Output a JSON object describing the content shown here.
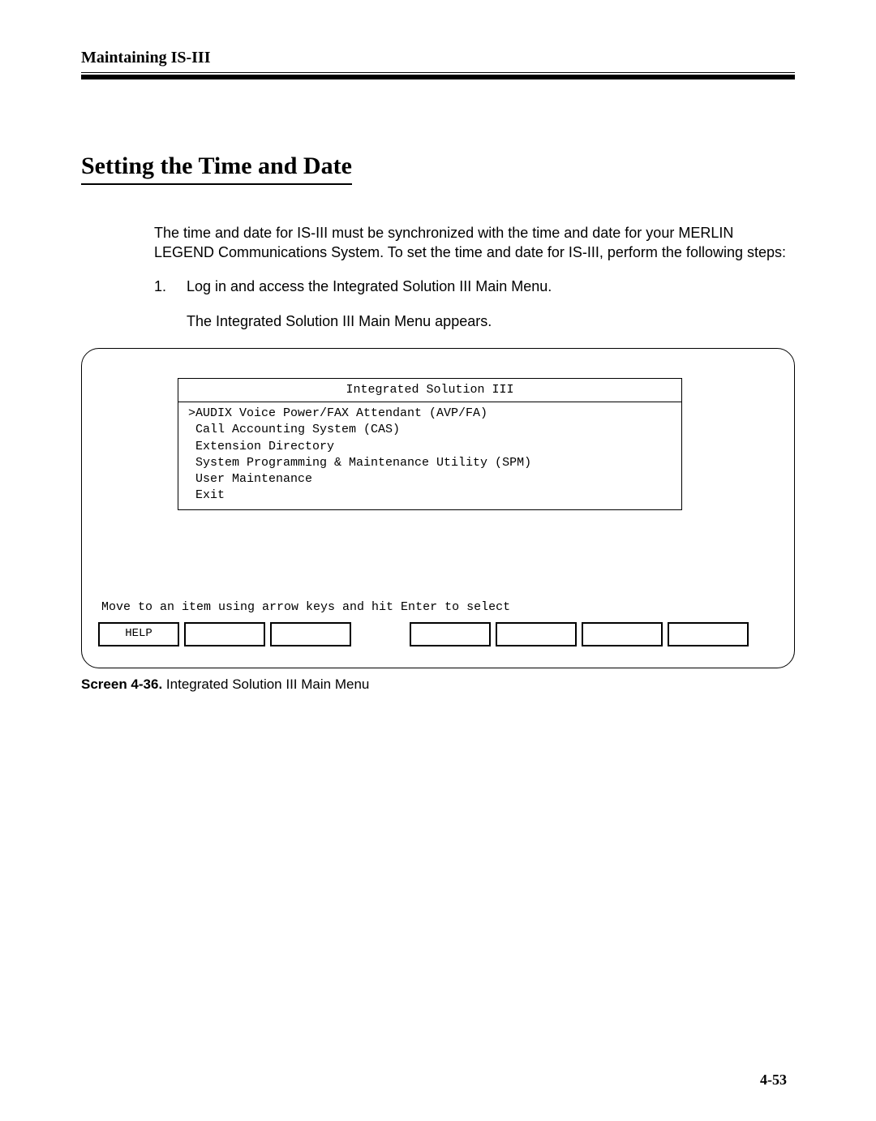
{
  "header": {
    "running_title": "Maintaining IS-III"
  },
  "section": {
    "title": "Setting the Time and Date",
    "intro": "The time and date for IS-III must be synchronized with the time and date for your MERLIN LEGEND Communications System. To set the time and date for IS-III, perform the following steps:",
    "step_number": "1.",
    "step_text": "Log in and access the Integrated Solution III Main Menu.",
    "step_result": "The Integrated Solution III Main Menu appears."
  },
  "terminal": {
    "title": "Integrated Solution III",
    "items": [
      ">AUDIX Voice Power/FAX Attendant (AVP/FA)",
      " Call Accounting System (CAS)",
      " Extension Directory",
      " System Programming & Maintenance Utility (SPM)",
      " User Maintenance",
      " Exit"
    ],
    "hint": "Move to an item using arrow keys and hit Enter to select",
    "fkeys": [
      "HELP",
      "",
      "",
      "",
      "",
      "",
      "",
      ""
    ]
  },
  "figure": {
    "label": "Screen 4-36.",
    "caption": "Integrated Solution III Main Menu"
  },
  "page_number": "4-53"
}
